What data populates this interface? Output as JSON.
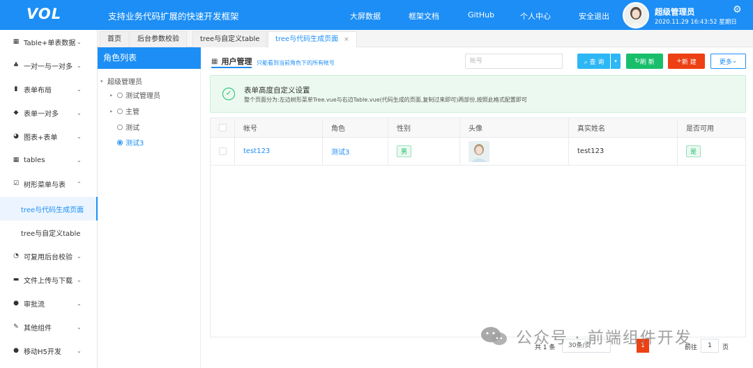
{
  "header": {
    "logo": "VOL",
    "slogan": "支持业务代码扩展的快速开发框架",
    "nav": [
      "大屏数据",
      "框架文档",
      "GitHub",
      "个人中心",
      "安全退出"
    ],
    "user_name": "超级管理员",
    "user_time": "2020.11.29 16:43:52 星期日",
    "icons": {
      "settings": "gear-icon",
      "avatar": "avatar"
    }
  },
  "sidebar": {
    "items": [
      {
        "label": "Table+单表数据",
        "icon": "grid-icon"
      },
      {
        "label": "一对一与一对多",
        "icon": "cluster-icon"
      },
      {
        "label": "表单布局",
        "icon": "bar-chart-icon"
      },
      {
        "label": "表单一对多",
        "icon": "cube-icon"
      },
      {
        "label": "图表+表单",
        "icon": "pie-chart-icon"
      },
      {
        "label": "tables",
        "icon": "grid-icon"
      },
      {
        "label": "树形菜单与表",
        "icon": "tree-icon"
      }
    ],
    "sub_items": [
      {
        "label": "tree与代码生成页面",
        "active": true
      },
      {
        "label": "tree与自定义table",
        "active": false
      }
    ],
    "items_after": [
      {
        "label": "可复用后台校验",
        "icon": "rss-icon"
      },
      {
        "label": "文件上传与下载",
        "icon": "folder-icon"
      },
      {
        "label": "审批流",
        "icon": "globe-icon"
      },
      {
        "label": "其他组件",
        "icon": "wrench-icon"
      },
      {
        "label": "移动H5开发",
        "icon": "apple-icon"
      }
    ]
  },
  "tabs": [
    {
      "label": "首页",
      "active": false
    },
    {
      "label": "后台参数校验",
      "active": false
    },
    {
      "label": "tree与自定义table",
      "active": false
    },
    {
      "label": "tree与代码生成页面",
      "active": true,
      "close": "×"
    }
  ],
  "role_panel": {
    "title": "角色列表",
    "tree": [
      {
        "label": "超级管理员",
        "level": 0
      },
      {
        "label": "测试管理员",
        "level": 1,
        "caret": true
      },
      {
        "label": "主管",
        "level": 1,
        "caret": true
      },
      {
        "label": "测试",
        "level": 1,
        "caret": false
      },
      {
        "label": "测试3",
        "level": 1,
        "caret": false,
        "active": true
      }
    ]
  },
  "main": {
    "title": "用户管理",
    "subtitle": "只能看到当前角色下的所有帐号",
    "search_placeholder": "帐号",
    "buttons": {
      "query": "查 询",
      "refresh": "刷 新",
      "new": "新 建",
      "more": "更多"
    },
    "alert": {
      "title": "表单高度自定义设置",
      "desc": "整个页面分为:左边树形菜单Tree.vue与右边Table.vue(代码生成的页面,复制过来即可)两部份,按照此格式配置即可"
    },
    "table": {
      "columns": [
        "帐号",
        "角色",
        "性别",
        "头像",
        "真实姓名",
        "是否可用"
      ],
      "rows": [
        {
          "account": "test123",
          "role": "测试3",
          "gender": "男",
          "real_name": "test123",
          "enabled": "是"
        }
      ]
    },
    "pager": {
      "total": "共 1 条",
      "page_size": "30条/页",
      "current": "1",
      "goto_label": "前往",
      "goto_value": "1",
      "page_label": "页"
    }
  },
  "watermark": "公众号 · 前端组件开发",
  "colors": {
    "primary": "#1c8ef5",
    "query": "#2db7f5",
    "refresh": "#19be6b",
    "new": "#ed4014"
  }
}
